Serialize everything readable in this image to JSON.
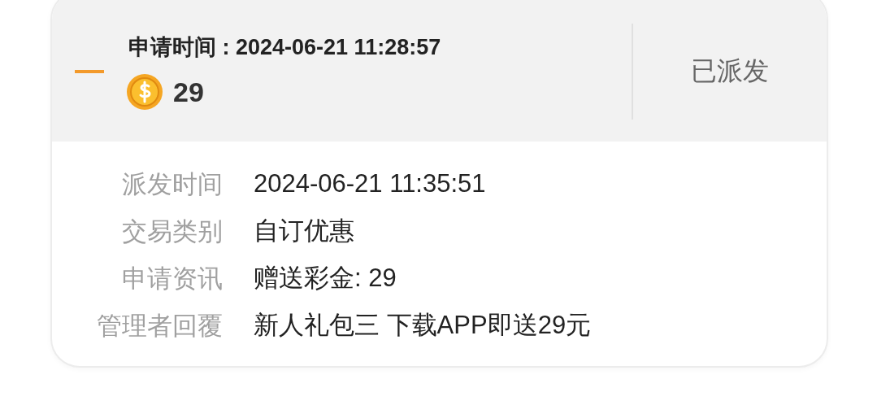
{
  "record": {
    "apply_time_label": "申请时间 : 2024-06-21 11:28:57",
    "coins": "29",
    "status": "已派发",
    "details": [
      {
        "label": "派发时间",
        "value": "2024-06-21 11:35:51"
      },
      {
        "label": "交易类别",
        "value": "自订优惠"
      },
      {
        "label": "申请资讯",
        "value": "赠送彩金: 29"
      },
      {
        "label": "管理者回覆",
        "value": "新人礼包三 下载APP即送29元"
      }
    ]
  }
}
